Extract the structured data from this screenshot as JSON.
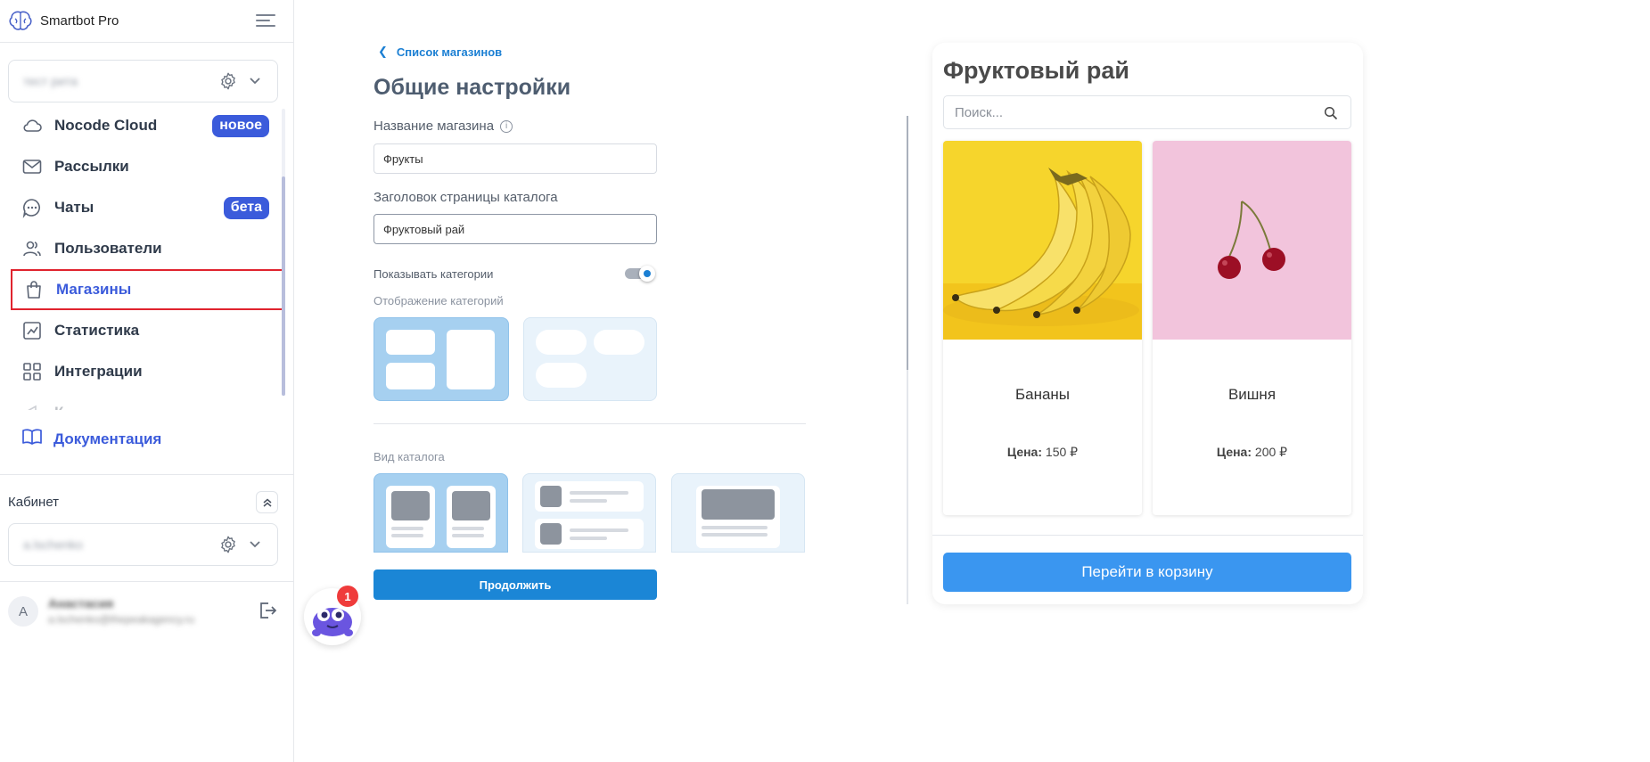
{
  "app": {
    "name": "Smartbot Pro"
  },
  "workspace": {
    "name": "тест рита"
  },
  "nav": {
    "items": [
      {
        "label": "Nocode Cloud",
        "badge": "новое"
      },
      {
        "label": "Рассылки"
      },
      {
        "label": "Чаты",
        "badge": "бета"
      },
      {
        "label": "Пользователи"
      },
      {
        "label": "Магазины"
      },
      {
        "label": "Статистика"
      },
      {
        "label": "Интеграции"
      },
      {
        "label": "К"
      }
    ],
    "docs_label": "Документация"
  },
  "cabinet": {
    "title": "Кабинет",
    "selected": "a.lschenko"
  },
  "user": {
    "initial": "А",
    "name": "Анастасия",
    "email": "a.lschenko@thepeakagency.ru"
  },
  "main": {
    "back_label": "Список магазинов",
    "title": "Общие настройки",
    "store_name_label": "Название магазина",
    "store_name_value": "Фрукты",
    "catalog_title_label": "Заголовок страницы каталога",
    "catalog_title_value": "Фруктовый рай",
    "show_categories_label": "Показывать категории",
    "show_categories_on": true,
    "category_display_label": "Отображение категорий",
    "catalog_view_label": "Вид каталога",
    "continue_label": "Продолжить",
    "bot_notifications": "1"
  },
  "preview": {
    "title": "Фруктовый рай",
    "search_placeholder": "Поиск...",
    "products": [
      {
        "name": "Бананы",
        "price_label": "Цена:",
        "price": "150 ₽"
      },
      {
        "name": "Вишня",
        "price_label": "Цена:",
        "price": "200 ₽"
      }
    ],
    "cart_label": "Перейти в корзину"
  },
  "colors": {
    "accent": "#3b5bdb",
    "primary_button": "#1b86d6",
    "cart_button": "#3a96f0",
    "active_outline": "#e0232e"
  }
}
